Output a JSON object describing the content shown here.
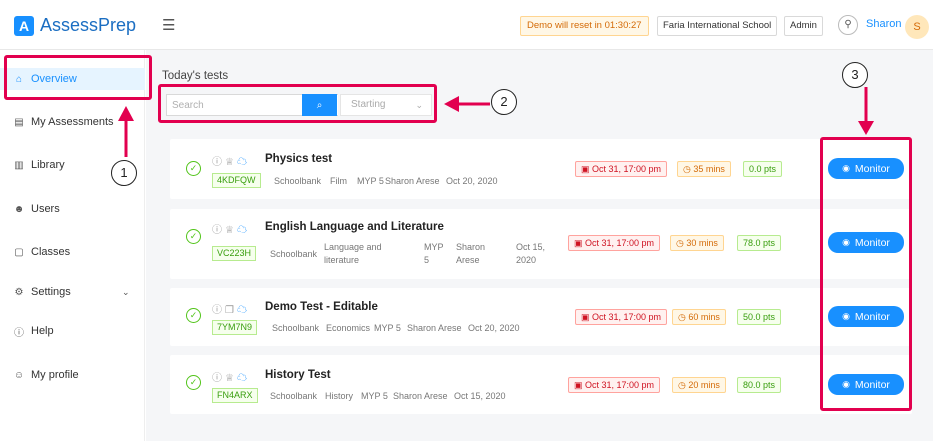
{
  "header": {
    "logo_letter": "A",
    "logo_text": "AssessPrep",
    "menu_icon": "hamburger-menu-icon",
    "demo_notice": "Demo will reset in 01:30:27",
    "school": "Faria International School",
    "role": "Admin",
    "user_name": "Sharon",
    "avatar_initial": "S"
  },
  "sidebar": {
    "items": [
      {
        "label": "Overview",
        "icon": "home-icon",
        "glyph": "⌂"
      },
      {
        "label": "My Assessments",
        "icon": "document-icon",
        "glyph": "▤"
      },
      {
        "label": "Library",
        "icon": "library-icon",
        "glyph": "▥"
      },
      {
        "label": "Users",
        "icon": "users-icon",
        "glyph": "☻"
      },
      {
        "label": "Classes",
        "icon": "classes-icon",
        "glyph": "▢"
      },
      {
        "label": "Settings",
        "icon": "gear-icon",
        "glyph": "⚙",
        "caret": "⌄"
      },
      {
        "label": "Help",
        "icon": "info-icon",
        "glyph": "ⓘ"
      },
      {
        "label": "My profile",
        "icon": "person-icon",
        "glyph": "☺"
      }
    ]
  },
  "main": {
    "section_title": "Today's tests",
    "search_placeholder": "Search",
    "search_icon_glyph": "⌕",
    "filter_value": "Starting",
    "filter_chevron": "⌄",
    "monitor_label": "Monitor",
    "tests": [
      {
        "title": "Physics test",
        "code": "4KDFQW",
        "meta": [
          "Schoolbank",
          "Film",
          "MYP 5",
          "Sharon Arese",
          "Oct 20, 2020"
        ],
        "date": "Oct 31, 17:00 pm",
        "duration": "35 mins",
        "points": "0.0 pts"
      },
      {
        "title": "English Language and Literature",
        "code": "VC223H",
        "meta": [
          "Schoolbank",
          "Language and literature",
          "MYP 5",
          "Sharon Arese",
          "Oct 15, 2020"
        ],
        "date": "Oct 31, 17:00 pm",
        "duration": "30 mins",
        "points": "78.0 pts"
      },
      {
        "title": "Demo Test - Editable",
        "code": "7YM7N9",
        "meta": [
          "Schoolbank",
          "Economics",
          "MYP 5",
          "Sharon Arese",
          "Oct 20, 2020"
        ],
        "date": "Oct 31, 17:00 pm",
        "duration": "60 mins",
        "points": "50.0 pts"
      },
      {
        "title": "History Test",
        "code": "FN4ARX",
        "meta": [
          "Schoolbank",
          "History",
          "MYP 5",
          "Sharon Arese",
          "Oct 15, 2020"
        ],
        "date": "Oct 31, 17:00 pm",
        "duration": "20 mins",
        "points": "80.0 pts"
      }
    ]
  },
  "annotations": {
    "labels": [
      "1",
      "2",
      "3"
    ],
    "color": "#e2004f"
  }
}
